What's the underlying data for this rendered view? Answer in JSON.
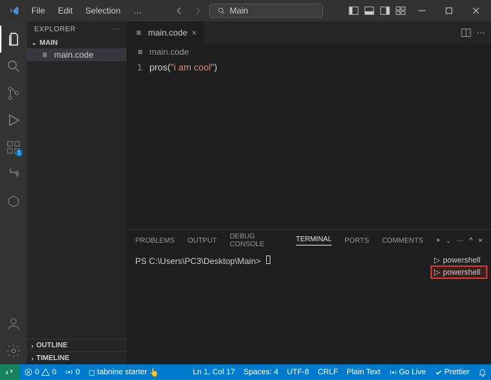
{
  "titlebar": {
    "menu": [
      "File",
      "Edit",
      "Selection"
    ],
    "ellipsis": "…",
    "search_label": "Main"
  },
  "sidebar": {
    "title": "EXPLORER",
    "folder": "MAIN",
    "file": "main.code",
    "outline": "OUTLINE",
    "timeline": "TIMELINE"
  },
  "editor": {
    "tab_name": "main.code",
    "breadcrumb": "main.code",
    "line_number": "1",
    "code_fn": "pros",
    "code_paren_open": "(",
    "code_str": "\"i am cool\"",
    "code_paren_close": ")"
  },
  "panel": {
    "tabs": {
      "problems": "PROBLEMS",
      "output": "OUTPUT",
      "debug": "DEBUG CONSOLE",
      "terminal": "TERMINAL",
      "ports": "PORTS",
      "comments": "COMMENTS"
    },
    "prompt": "PS C:\\Users\\PC3\\Desktop\\Main>",
    "terms": [
      "powershell",
      "powershell"
    ]
  },
  "status": {
    "errors": "0",
    "warnings": "0",
    "ports": "0",
    "tabnine": "tabnine starter",
    "lncol": "Ln 1, Col 17",
    "spaces": "Spaces: 4",
    "enc": "UTF-8",
    "eol": "CRLF",
    "lang": "Plain Text",
    "golive": "Go Live",
    "prettier": "Prettier"
  }
}
